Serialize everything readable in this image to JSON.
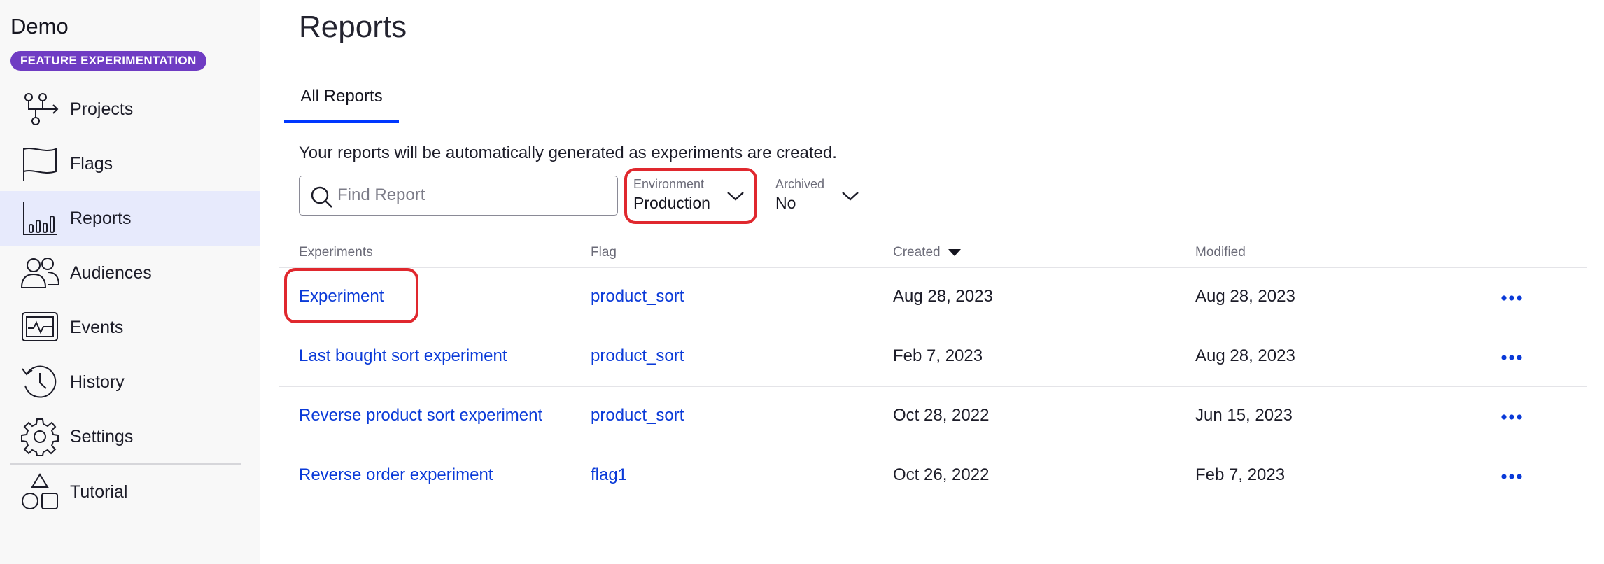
{
  "app": {
    "title": "Demo",
    "badge": "FEATURE EXPERIMENTATION"
  },
  "sidebar": {
    "items": [
      {
        "label": "Projects",
        "icon": "projects-icon"
      },
      {
        "label": "Flags",
        "icon": "flag-icon"
      },
      {
        "label": "Reports",
        "icon": "reports-icon",
        "active": true
      },
      {
        "label": "Audiences",
        "icon": "audiences-icon"
      },
      {
        "label": "Events",
        "icon": "events-icon"
      },
      {
        "label": "History",
        "icon": "history-icon"
      },
      {
        "label": "Settings",
        "icon": "gear-icon"
      },
      {
        "label": "Tutorial",
        "icon": "tutorial-icon"
      }
    ]
  },
  "page": {
    "title": "Reports",
    "tabs": [
      {
        "label": "All Reports",
        "active": true
      }
    ],
    "intro": "Your reports will be automatically generated as experiments are created."
  },
  "filters": {
    "search_placeholder": "Find Report",
    "search_value": "",
    "environment": {
      "label": "Environment",
      "value": "Production"
    },
    "archived": {
      "label": "Archived",
      "value": "No"
    }
  },
  "table": {
    "headers": {
      "experiments": "Experiments",
      "flag": "Flag",
      "created": "Created",
      "modified": "Modified"
    },
    "rows": [
      {
        "experiment": "Experiment",
        "flag": "product_sort",
        "created": "Aug 28, 2023",
        "modified": "Aug 28, 2023"
      },
      {
        "experiment": "Last bought sort experiment",
        "flag": "product_sort",
        "created": "Feb 7, 2023",
        "modified": "Aug 28, 2023"
      },
      {
        "experiment": "Reverse product sort experiment",
        "flag": "product_sort",
        "created": "Oct 28, 2022",
        "modified": "Jun 15, 2023"
      },
      {
        "experiment": "Reverse order experiment",
        "flag": "flag1",
        "created": "Oct 26, 2022",
        "modified": "Feb 7, 2023"
      }
    ]
  },
  "colors": {
    "accent": "#0037ff",
    "link": "#0a3ad8",
    "badge": "#6f3cc3",
    "highlight": "#e0282e",
    "active_nav": "#e7eafc"
  }
}
